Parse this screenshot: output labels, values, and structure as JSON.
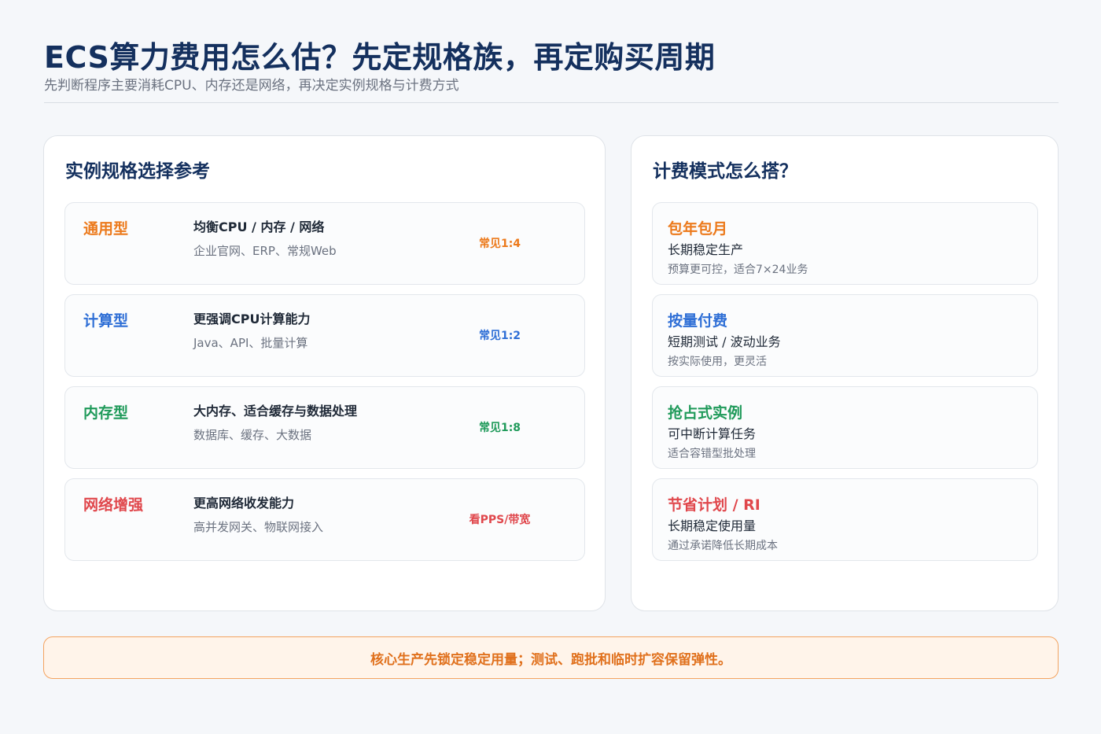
{
  "header": {
    "title": "ECS算力费用怎么估？先定规格族，再定购买周期",
    "subtitle": "先判断程序主要消耗CPU、内存还是网络，再决定实例规格与计费方式"
  },
  "left_panel": {
    "title": "实例规格选择参考",
    "cards": [
      {
        "name": "通用型",
        "main": "均衡CPU / 内存 / 网络",
        "sub": "企业官网、ERP、常规Web",
        "ratio": "常见1:4",
        "color": "#ec7a1c"
      },
      {
        "name": "计算型",
        "main": "更强调CPU计算能力",
        "sub": "Java、API、批量计算",
        "ratio": "常见1:2",
        "color": "#2f6fd6"
      },
      {
        "name": "内存型",
        "main": "大内存、适合缓存与数据处理",
        "sub": "数据库、缓存、大数据",
        "ratio": "常见1:8",
        "color": "#1f9a5a"
      },
      {
        "name": "网络增强",
        "main": "更高网络收发能力",
        "sub": "高并发网关、物联网接入",
        "ratio": "看PPS/带宽",
        "color": "#e0474c"
      }
    ]
  },
  "right_panel": {
    "title": "计费模式怎么搭？",
    "cards": [
      {
        "name": "包年包月",
        "main": "长期稳定生产",
        "sub": "预算更可控，适合7×24业务",
        "color": "#ec7a1c"
      },
      {
        "name": "按量付费",
        "main": "短期测试 / 波动业务",
        "sub": "按实际使用，更灵活",
        "color": "#2f6fd6"
      },
      {
        "name": "抢占式实例",
        "main": "可中断计算任务",
        "sub": "适合容错型批处理",
        "color": "#1f9a5a"
      },
      {
        "name": "节省计划 / RI",
        "main": "长期稳定使用量",
        "sub": "通过承诺降低长期成本",
        "color": "#e0474c"
      }
    ]
  },
  "banner": {
    "text": "核心生产先锁定稳定用量；测试、跑批和临时扩容保留弹性。"
  }
}
